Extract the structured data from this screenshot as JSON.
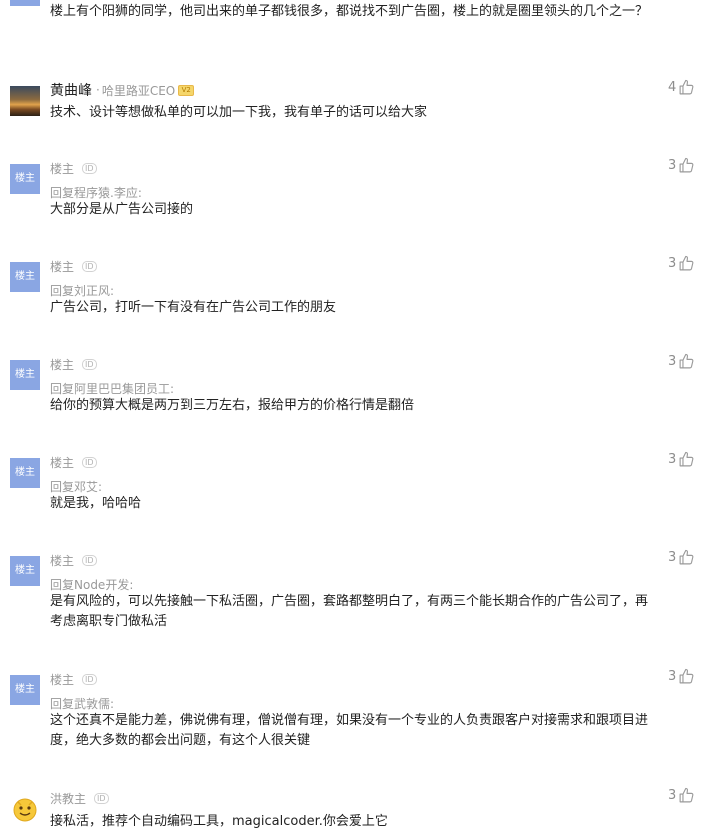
{
  "top_fragment": {
    "content": "楼上有个阳狮的同学，他司出来的单子都钱很多，都说找不到广告圈，楼上的就是圈里领头的几个之一？"
  },
  "comments": [
    {
      "name": "黄曲峰",
      "separator": "·",
      "title": "哈里路亚CEO",
      "badge": "V2",
      "content": "技术、设计等想做私单的可以加一下我，我有单子的话可以给大家",
      "likes": "4"
    },
    {
      "avatar": "楼主",
      "name": "楼主",
      "id_badge": "ID",
      "reply_to": "回复程序猿.李应:",
      "content": "大部分是从广告公司接的",
      "likes": "3"
    },
    {
      "avatar": "楼主",
      "name": "楼主",
      "id_badge": "ID",
      "reply_to": "回复刘正风:",
      "content": "广告公司，打听一下有没有在广告公司工作的朋友",
      "likes": "3"
    },
    {
      "avatar": "楼主",
      "name": "楼主",
      "id_badge": "ID",
      "reply_to": "回复阿里巴巴集团员工:",
      "content": "给你的预算大概是两万到三万左右，报给甲方的价格行情是翻倍",
      "likes": "3"
    },
    {
      "avatar": "楼主",
      "name": "楼主",
      "id_badge": "ID",
      "reply_to": "回复邓艾:",
      "content": "就是我，哈哈哈",
      "likes": "3"
    },
    {
      "avatar": "楼主",
      "name": "楼主",
      "id_badge": "ID",
      "reply_to": "回复Node开发:",
      "content": "是有风险的，可以先接触一下私活圈，广告圈，套路都整明白了，有两三个能长期合作的广告公司了，再考虑离职专门做私活",
      "likes": "3"
    },
    {
      "avatar": "楼主",
      "name": "楼主",
      "id_badge": "ID",
      "reply_to": "回复武敦儒:",
      "content": "这个还真不是能力差，佛说佛有理，僧说僧有理，如果没有一个专业的人负责跟客户对接需求和跟项目进度，绝大多数的都会出问题，有这个人很关键",
      "likes": "3"
    },
    {
      "name": "洪教主",
      "id_badge": "ID",
      "content": "接私活，推荐个自动编码工具，magicalcoder.你会爱上它",
      "likes": "3"
    }
  ],
  "colors": {
    "avatar_blue": "#8aa6e3",
    "muted_text": "#999999",
    "body_text": "#222222"
  },
  "icons": {
    "like": "thumbs-up-icon"
  }
}
